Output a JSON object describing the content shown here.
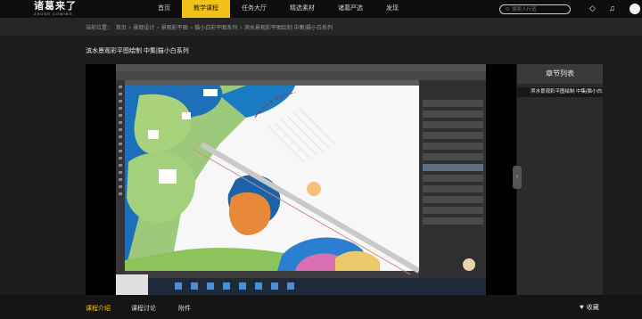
{
  "header": {
    "logo_cn": "诸葛来了",
    "logo_en": "ZHUGE COMING",
    "nav": [
      "首页",
      "教学课程",
      "任务大厅",
      "精选素材",
      "诸葛严选",
      "发现"
    ],
    "active_nav": 1,
    "search_placeholder": "搜索人行道"
  },
  "breadcrumb": {
    "label": "当前位置：",
    "items": [
      "首页",
      "景观设计",
      "景观彩平图",
      "猫小白彩平图系列",
      "滨水景观彩平图绘制 中集|猫小白系列"
    ]
  },
  "lesson": {
    "title": "滨水景观彩平图绘制 中集|猫小白系列"
  },
  "side_panel": {
    "header": "章节列表",
    "items": [
      "滨水景观彩平图绘制 中集|猫小白系列"
    ]
  },
  "footer": {
    "tabs": [
      "课程介绍",
      "课程讨论",
      "附件"
    ],
    "active_tab": 0,
    "favorite": "收藏"
  },
  "colors": {
    "accent": "#f2c21a",
    "background": "#1c1c1c",
    "water": "#1d6fb8",
    "grass": "#8dc25a"
  }
}
